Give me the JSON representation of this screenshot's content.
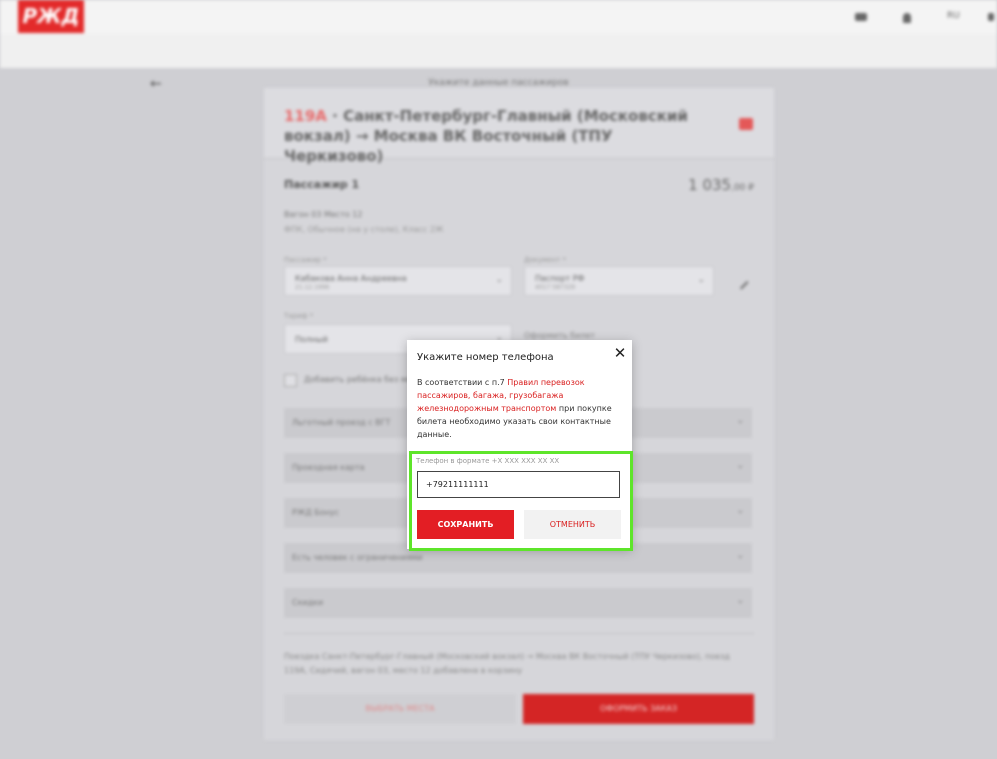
{
  "header": {
    "logo_text": "РЖД",
    "right_items": [
      "RUB",
      "RU"
    ],
    "page_title": "Укажите данные пассажиров"
  },
  "trip": {
    "train_number": "119А",
    "route": " · Санкт-Петербург-Главный (Московский вокзал) → Москва ВК Восточный (ТПУ Черкизово)"
  },
  "passenger": {
    "title": "Пассажир 1",
    "price_main": "1 035",
    "price_cents": ",00 ₽",
    "seat": "Вагон 03 Место 12",
    "seat_details": "ФПК, Обычное (на у столе), Класс 2Ж",
    "fields": {
      "passenger_label": "Пассажир *",
      "passenger_value": "Кабакова Анна Андреевна",
      "passenger_sub": "21.12.1996",
      "document_label": "Документ *",
      "document_value": "Паспорт РФ",
      "document_sub": "4017 587329",
      "tariff_label": "Тариф *",
      "tariff_value": "Полный"
    },
    "right_note": "Оформить билет",
    "child_checkbox": "Добавить ребёнка без места",
    "accordions": [
      "Льготный проезд с ВГТ",
      "Проездная карта",
      "РЖД Бонус",
      "Есть человек с ограничениями",
      "Скидки"
    ],
    "note": "Поездка Санкт-Петербург-Главный (Московский вокзал) → Москва ВК Восточный (ТПУ Черкизово), поезд 119А, Сидячий, вагон 03, место 12 добавлена в корзину",
    "back_button": "ВЫБРАТЬ МЕСТА",
    "order_button": "ОФОРМИТЬ ЗАКАЗ"
  },
  "modal": {
    "title": "Укажите номер телефона",
    "text_before": "В соответствии с п.7 ",
    "link_text": "Правил перевозок пассажиров, багажа, грузобагажа железнодорожным транспортом",
    "text_after": " при покупке билета необходимо указать свои контактные данные.",
    "phone_label": "Телефон в формате +Х ХХХ ХХХ ХХ ХХ",
    "phone_value": "+79211111111",
    "save_label": "СОХРАНИТЬ",
    "cancel_label": "ОТМЕНИТЬ"
  },
  "colors": {
    "brand_red": "#e31e24",
    "highlight_green": "#5ee52a"
  }
}
